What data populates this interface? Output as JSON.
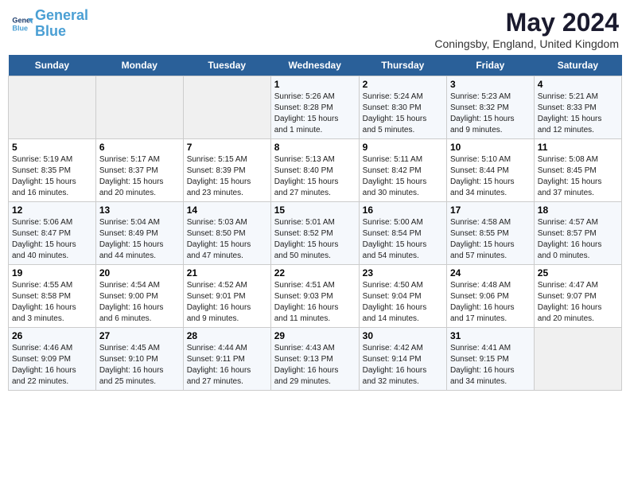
{
  "header": {
    "logo_line1": "General",
    "logo_line2": "Blue",
    "title": "May 2024",
    "subtitle": "Coningsby, England, United Kingdom"
  },
  "days": [
    "Sunday",
    "Monday",
    "Tuesday",
    "Wednesday",
    "Thursday",
    "Friday",
    "Saturday"
  ],
  "weeks": [
    {
      "cells": [
        {
          "date": "",
          "empty": true
        },
        {
          "date": "",
          "empty": true
        },
        {
          "date": "",
          "empty": true
        },
        {
          "date": "1",
          "lines": [
            "Sunrise: 5:26 AM",
            "Sunset: 8:28 PM",
            "Daylight: 15 hours",
            "and 1 minute."
          ]
        },
        {
          "date": "2",
          "lines": [
            "Sunrise: 5:24 AM",
            "Sunset: 8:30 PM",
            "Daylight: 15 hours",
            "and 5 minutes."
          ]
        },
        {
          "date": "3",
          "lines": [
            "Sunrise: 5:23 AM",
            "Sunset: 8:32 PM",
            "Daylight: 15 hours",
            "and 9 minutes."
          ]
        },
        {
          "date": "4",
          "lines": [
            "Sunrise: 5:21 AM",
            "Sunset: 8:33 PM",
            "Daylight: 15 hours",
            "and 12 minutes."
          ]
        }
      ]
    },
    {
      "cells": [
        {
          "date": "5",
          "lines": [
            "Sunrise: 5:19 AM",
            "Sunset: 8:35 PM",
            "Daylight: 15 hours",
            "and 16 minutes."
          ]
        },
        {
          "date": "6",
          "lines": [
            "Sunrise: 5:17 AM",
            "Sunset: 8:37 PM",
            "Daylight: 15 hours",
            "and 20 minutes."
          ]
        },
        {
          "date": "7",
          "lines": [
            "Sunrise: 5:15 AM",
            "Sunset: 8:39 PM",
            "Daylight: 15 hours",
            "and 23 minutes."
          ]
        },
        {
          "date": "8",
          "lines": [
            "Sunrise: 5:13 AM",
            "Sunset: 8:40 PM",
            "Daylight: 15 hours",
            "and 27 minutes."
          ]
        },
        {
          "date": "9",
          "lines": [
            "Sunrise: 5:11 AM",
            "Sunset: 8:42 PM",
            "Daylight: 15 hours",
            "and 30 minutes."
          ]
        },
        {
          "date": "10",
          "lines": [
            "Sunrise: 5:10 AM",
            "Sunset: 8:44 PM",
            "Daylight: 15 hours",
            "and 34 minutes."
          ]
        },
        {
          "date": "11",
          "lines": [
            "Sunrise: 5:08 AM",
            "Sunset: 8:45 PM",
            "Daylight: 15 hours",
            "and 37 minutes."
          ]
        }
      ]
    },
    {
      "cells": [
        {
          "date": "12",
          "lines": [
            "Sunrise: 5:06 AM",
            "Sunset: 8:47 PM",
            "Daylight: 15 hours",
            "and 40 minutes."
          ]
        },
        {
          "date": "13",
          "lines": [
            "Sunrise: 5:04 AM",
            "Sunset: 8:49 PM",
            "Daylight: 15 hours",
            "and 44 minutes."
          ]
        },
        {
          "date": "14",
          "lines": [
            "Sunrise: 5:03 AM",
            "Sunset: 8:50 PM",
            "Daylight: 15 hours",
            "and 47 minutes."
          ]
        },
        {
          "date": "15",
          "lines": [
            "Sunrise: 5:01 AM",
            "Sunset: 8:52 PM",
            "Daylight: 15 hours",
            "and 50 minutes."
          ]
        },
        {
          "date": "16",
          "lines": [
            "Sunrise: 5:00 AM",
            "Sunset: 8:54 PM",
            "Daylight: 15 hours",
            "and 54 minutes."
          ]
        },
        {
          "date": "17",
          "lines": [
            "Sunrise: 4:58 AM",
            "Sunset: 8:55 PM",
            "Daylight: 15 hours",
            "and 57 minutes."
          ]
        },
        {
          "date": "18",
          "lines": [
            "Sunrise: 4:57 AM",
            "Sunset: 8:57 PM",
            "Daylight: 16 hours",
            "and 0 minutes."
          ]
        }
      ]
    },
    {
      "cells": [
        {
          "date": "19",
          "lines": [
            "Sunrise: 4:55 AM",
            "Sunset: 8:58 PM",
            "Daylight: 16 hours",
            "and 3 minutes."
          ]
        },
        {
          "date": "20",
          "lines": [
            "Sunrise: 4:54 AM",
            "Sunset: 9:00 PM",
            "Daylight: 16 hours",
            "and 6 minutes."
          ]
        },
        {
          "date": "21",
          "lines": [
            "Sunrise: 4:52 AM",
            "Sunset: 9:01 PM",
            "Daylight: 16 hours",
            "and 9 minutes."
          ]
        },
        {
          "date": "22",
          "lines": [
            "Sunrise: 4:51 AM",
            "Sunset: 9:03 PM",
            "Daylight: 16 hours",
            "and 11 minutes."
          ]
        },
        {
          "date": "23",
          "lines": [
            "Sunrise: 4:50 AM",
            "Sunset: 9:04 PM",
            "Daylight: 16 hours",
            "and 14 minutes."
          ]
        },
        {
          "date": "24",
          "lines": [
            "Sunrise: 4:48 AM",
            "Sunset: 9:06 PM",
            "Daylight: 16 hours",
            "and 17 minutes."
          ]
        },
        {
          "date": "25",
          "lines": [
            "Sunrise: 4:47 AM",
            "Sunset: 9:07 PM",
            "Daylight: 16 hours",
            "and 20 minutes."
          ]
        }
      ]
    },
    {
      "cells": [
        {
          "date": "26",
          "lines": [
            "Sunrise: 4:46 AM",
            "Sunset: 9:09 PM",
            "Daylight: 16 hours",
            "and 22 minutes."
          ]
        },
        {
          "date": "27",
          "lines": [
            "Sunrise: 4:45 AM",
            "Sunset: 9:10 PM",
            "Daylight: 16 hours",
            "and 25 minutes."
          ]
        },
        {
          "date": "28",
          "lines": [
            "Sunrise: 4:44 AM",
            "Sunset: 9:11 PM",
            "Daylight: 16 hours",
            "and 27 minutes."
          ]
        },
        {
          "date": "29",
          "lines": [
            "Sunrise: 4:43 AM",
            "Sunset: 9:13 PM",
            "Daylight: 16 hours",
            "and 29 minutes."
          ]
        },
        {
          "date": "30",
          "lines": [
            "Sunrise: 4:42 AM",
            "Sunset: 9:14 PM",
            "Daylight: 16 hours",
            "and 32 minutes."
          ]
        },
        {
          "date": "31",
          "lines": [
            "Sunrise: 4:41 AM",
            "Sunset: 9:15 PM",
            "Daylight: 16 hours",
            "and 34 minutes."
          ]
        },
        {
          "date": "",
          "empty": true
        }
      ]
    }
  ]
}
